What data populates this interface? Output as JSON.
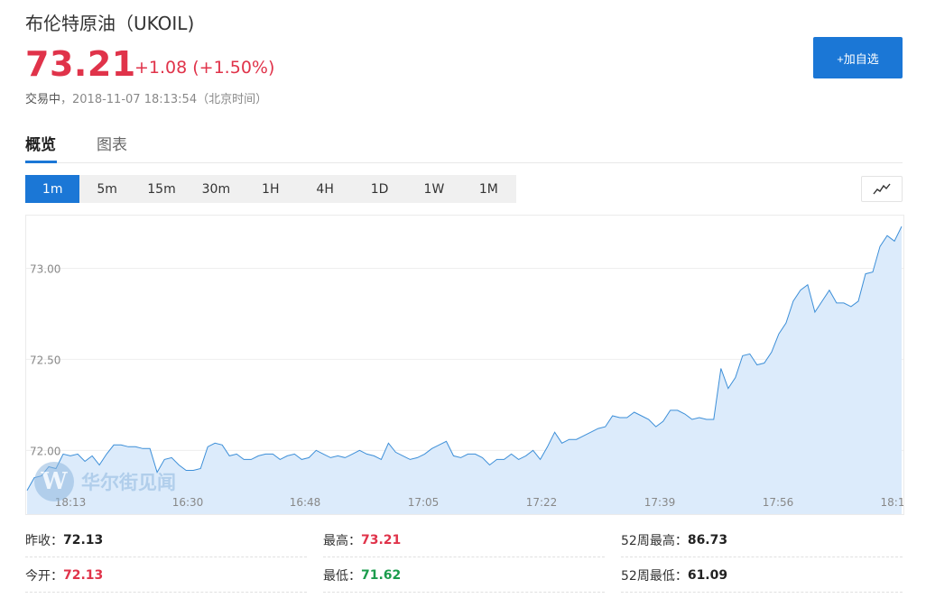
{
  "header": {
    "title": "布伦特原油（UKOIL)",
    "price": "73.21",
    "change": "+1.08 (+1.50%)",
    "status": "交易中",
    "timestamp": "，2018-11-07 18:13:54（北京时间）",
    "add_button": "+加自选"
  },
  "tabs": [
    {
      "label": "概览",
      "active": true
    },
    {
      "label": "图表",
      "active": false
    }
  ],
  "periods": [
    {
      "label": "1m",
      "active": true
    },
    {
      "label": "5m",
      "active": false
    },
    {
      "label": "15m",
      "active": false
    },
    {
      "label": "30m",
      "active": false
    },
    {
      "label": "1H",
      "active": false
    },
    {
      "label": "4H",
      "active": false
    },
    {
      "label": "1D",
      "active": false
    },
    {
      "label": "1W",
      "active": false
    },
    {
      "label": "1M",
      "active": false
    }
  ],
  "chart_type_icon": "line-chart-icon",
  "watermark": {
    "logo": "W",
    "text": "华尔街见闻"
  },
  "chart_data": {
    "type": "area",
    "ylim": [
      71.64,
      73.29
    ],
    "y_ticks": [
      "72.00",
      "72.50",
      "73.00"
    ],
    "x_ticks": [
      "18:13",
      "16:30",
      "16:48",
      "17:05",
      "17:22",
      "17:39",
      "17:56",
      "18:1"
    ],
    "line_color": "#3d8fd8",
    "fill_color": "#dcebfb",
    "x": [
      "16:13",
      "16:14",
      "16:15",
      "16:16",
      "16:17",
      "16:18",
      "16:19",
      "16:20",
      "16:21",
      "16:22",
      "16:23",
      "16:24",
      "16:25",
      "16:26",
      "16:27",
      "16:28",
      "16:29",
      "16:30",
      "16:31",
      "16:32",
      "16:33",
      "16:34",
      "16:35",
      "16:36",
      "16:37",
      "16:38",
      "16:39",
      "16:40",
      "16:41",
      "16:42",
      "16:43",
      "16:44",
      "16:45",
      "16:46",
      "16:47",
      "16:48",
      "16:49",
      "16:50",
      "16:51",
      "16:52",
      "16:53",
      "16:54",
      "16:55",
      "16:56",
      "16:57",
      "16:58",
      "16:59",
      "17:00",
      "17:01",
      "17:02",
      "17:03",
      "17:04",
      "17:05",
      "17:06",
      "17:07",
      "17:08",
      "17:09",
      "17:10",
      "17:11",
      "17:12",
      "17:13",
      "17:14",
      "17:15",
      "17:16",
      "17:17",
      "17:18",
      "17:19",
      "17:20",
      "17:21",
      "17:22",
      "17:23",
      "17:24",
      "17:25",
      "17:26",
      "17:27",
      "17:28",
      "17:29",
      "17:30",
      "17:31",
      "17:32",
      "17:33",
      "17:34",
      "17:35",
      "17:36",
      "17:37",
      "17:38",
      "17:39",
      "17:40",
      "17:41",
      "17:42",
      "17:43",
      "17:44",
      "17:45",
      "17:46",
      "17:47",
      "17:48",
      "17:49",
      "17:50",
      "17:51",
      "17:52",
      "17:53",
      "17:54",
      "17:55",
      "17:56",
      "17:57",
      "17:58",
      "17:59",
      "18:00",
      "18:01",
      "18:02",
      "18:03",
      "18:04",
      "18:05",
      "18:06",
      "18:07",
      "18:08",
      "18:09",
      "18:10",
      "18:11",
      "18:12",
      "18:13"
    ],
    "values": [
      71.78,
      71.85,
      71.86,
      71.91,
      71.9,
      71.98,
      71.97,
      71.98,
      71.94,
      71.97,
      71.92,
      71.98,
      72.03,
      72.03,
      72.02,
      72.02,
      72.01,
      72.01,
      71.88,
      71.95,
      71.96,
      71.92,
      71.89,
      71.89,
      71.9,
      72.02,
      72.04,
      72.03,
      71.97,
      71.98,
      71.95,
      71.95,
      71.97,
      71.98,
      71.98,
      71.95,
      71.97,
      71.98,
      71.95,
      71.96,
      72.0,
      71.98,
      71.96,
      71.97,
      71.96,
      71.98,
      72.0,
      71.98,
      71.97,
      71.95,
      72.04,
      71.99,
      71.97,
      71.95,
      71.96,
      71.98,
      72.01,
      72.03,
      72.05,
      71.97,
      71.96,
      71.98,
      71.98,
      71.96,
      71.92,
      71.95,
      71.95,
      71.98,
      71.95,
      71.97,
      72.0,
      71.95,
      72.02,
      72.1,
      72.04,
      72.06,
      72.06,
      72.08,
      72.1,
      72.12,
      72.13,
      72.19,
      72.18,
      72.18,
      72.21,
      72.19,
      72.17,
      72.13,
      72.16,
      72.22,
      72.22,
      72.2,
      72.17,
      72.18,
      72.17,
      72.17,
      72.45,
      72.34,
      72.4,
      72.52,
      72.53,
      72.47,
      72.48,
      72.54,
      72.64,
      72.7,
      72.82,
      72.88,
      72.91,
      72.76,
      72.82,
      72.88,
      72.81,
      72.81,
      72.79,
      72.82,
      72.97,
      72.98,
      73.12,
      73.18,
      73.15,
      73.23
    ]
  },
  "stats": [
    {
      "label": "昨收：",
      "value": "72.13",
      "color": "dark"
    },
    {
      "label": "最高：",
      "value": "73.21",
      "color": "red"
    },
    {
      "label": "52周最高：",
      "value": "86.73",
      "color": "dark"
    },
    {
      "label": "今开：",
      "value": "72.13",
      "color": "red"
    },
    {
      "label": "最低：",
      "value": "71.62",
      "color": "green"
    },
    {
      "label": "52周最低：",
      "value": "61.09",
      "color": "dark"
    }
  ]
}
